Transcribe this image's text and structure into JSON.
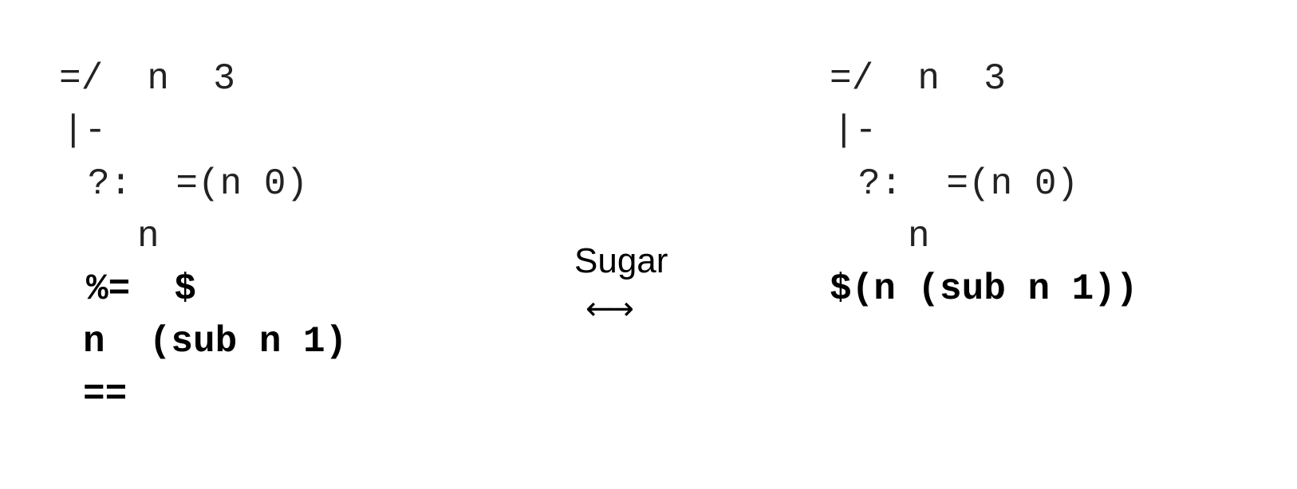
{
  "left_code": {
    "lines": [
      "=/  n  3",
      "|-",
      "?:  =(n 0)",
      "n",
      "%=  $",
      "n  (sub n 1)",
      "=="
    ]
  },
  "transform": {
    "label": "Sugar",
    "arrow": "←→"
  },
  "right_code": {
    "lines": [
      "=/  n  3",
      "|-",
      "?:  =(n 0)",
      "n",
      "$(n (sub n 1))"
    ]
  }
}
